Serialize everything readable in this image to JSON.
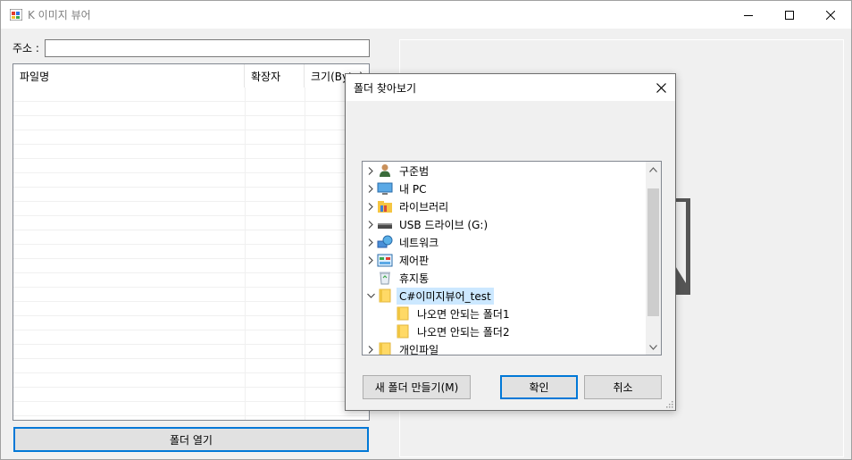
{
  "window": {
    "title": "K 이미지 뷰어",
    "controls": [
      "minimize",
      "maximize",
      "close"
    ]
  },
  "address": {
    "label": "주소 :",
    "value": ""
  },
  "listview": {
    "columns": [
      "파일명",
      "확장자",
      "크기(Byte)"
    ],
    "rows": []
  },
  "open_folder_button": "폴더 열기",
  "dialog": {
    "title": "폴더 찾아보기",
    "tree": [
      {
        "label": "구준범",
        "icon": "user-icon",
        "expander": "collapsed",
        "level": 0
      },
      {
        "label": "내 PC",
        "icon": "pc-icon",
        "expander": "collapsed",
        "level": 0
      },
      {
        "label": "라이브러리",
        "icon": "library-icon",
        "expander": "collapsed",
        "level": 0
      },
      {
        "label": "USB 드라이브 (G:)",
        "icon": "usb-drive-icon",
        "expander": "collapsed",
        "level": 0
      },
      {
        "label": "네트워크",
        "icon": "network-icon",
        "expander": "collapsed",
        "level": 0
      },
      {
        "label": "제어판",
        "icon": "control-panel-icon",
        "expander": "collapsed",
        "level": 0
      },
      {
        "label": "휴지통",
        "icon": "recycle-bin-icon",
        "expander": "none",
        "level": 0
      },
      {
        "label": "C#이미지뷰어_test",
        "icon": "folder-icon",
        "expander": "expanded",
        "level": 0,
        "selected": true
      },
      {
        "label": "나오면 안되는 폴더1",
        "icon": "folder-icon",
        "expander": "none",
        "level": 1
      },
      {
        "label": "나오면 안되는 폴더2",
        "icon": "folder-icon",
        "expander": "none",
        "level": 1
      },
      {
        "label": "개인파일",
        "icon": "folder-icon",
        "expander": "collapsed",
        "level": 0
      }
    ],
    "new_folder_button": "새 폴더 만들기(M)",
    "ok_button": "확인",
    "cancel_button": "취소"
  },
  "colors": {
    "accent": "#0078d7",
    "selection": "#cce8ff",
    "window_bg": "#f0f0f0",
    "folder": "#ffd966"
  }
}
